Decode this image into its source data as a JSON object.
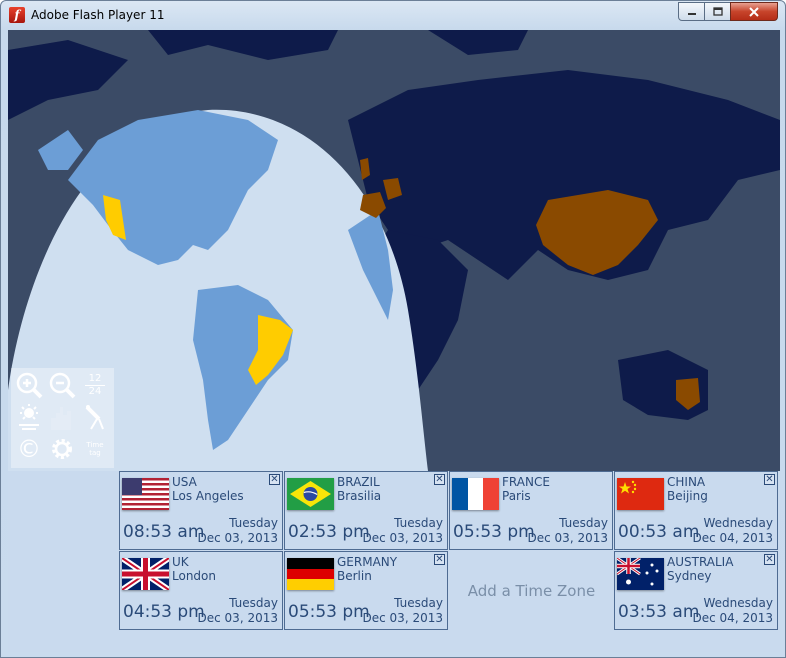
{
  "window": {
    "title": "Adobe Flash Player 11",
    "icon": "flash-icon",
    "controls": {
      "minimize": "minimize-icon",
      "maximize": "maximize-icon",
      "close": "close-icon"
    }
  },
  "colors": {
    "night": "#0e1b4a",
    "day_ocean": "#cfdff0",
    "day_land": "#6c9ed6",
    "night_ocean": "#3b4b66",
    "highlight_day": "#ffcc00",
    "highlight_night": "#8a4a00",
    "panel": "#c9daee",
    "text": "#2a4a78"
  },
  "tools": [
    {
      "icon": "zoom-in-icon"
    },
    {
      "icon": "zoom-out-icon"
    },
    {
      "icon": "12-24-hour-toggle-icon",
      "top": "12",
      "bottom": "24"
    },
    {
      "icon": "daylight-sun-icon"
    },
    {
      "icon": "city-skyline-icon"
    },
    {
      "icon": "night-telescope-icon"
    },
    {
      "icon": "copyright-icon",
      "glyph": "©"
    },
    {
      "icon": "settings-gear-icon"
    },
    {
      "icon": "time-tag-icon",
      "top": "Time",
      "bottom": "tag"
    }
  ],
  "clocks": [
    {
      "country": "USA",
      "city": "Los Angeles",
      "time": "08:53 am",
      "day": "Tuesday",
      "date": "Dec 03, 2013",
      "flag": "usa-flag-icon"
    },
    {
      "country": "BRAZIL",
      "city": "Brasilia",
      "time": "02:53 pm",
      "day": "Tuesday",
      "date": "Dec 03, 2013",
      "flag": "brazil-flag-icon"
    },
    {
      "country": "FRANCE",
      "city": "Paris",
      "time": "05:53 pm",
      "day": "Tuesday",
      "date": "Dec 03, 2013",
      "flag": "france-flag-icon"
    },
    {
      "country": "CHINA",
      "city": "Beijing",
      "time": "00:53 am",
      "day": "Wednesday",
      "date": "Dec 04, 2013",
      "flag": "china-flag-icon"
    },
    {
      "country": "UK",
      "city": "London",
      "time": "04:53 pm",
      "day": "Tuesday",
      "date": "Dec 03, 2013",
      "flag": "uk-flag-icon"
    },
    {
      "country": "GERMANY",
      "city": "Berlin",
      "time": "05:53 pm",
      "day": "Tuesday",
      "date": "Dec 03, 2013",
      "flag": "germany-flag-icon"
    },
    {
      "country": "AUSTRALIA",
      "city": "Sydney",
      "time": "03:53 am",
      "day": "Wednesday",
      "date": "Dec 04, 2013",
      "flag": "australia-flag-icon"
    }
  ],
  "add_zone_label": "Add a Time Zone",
  "close_glyph": "✕"
}
